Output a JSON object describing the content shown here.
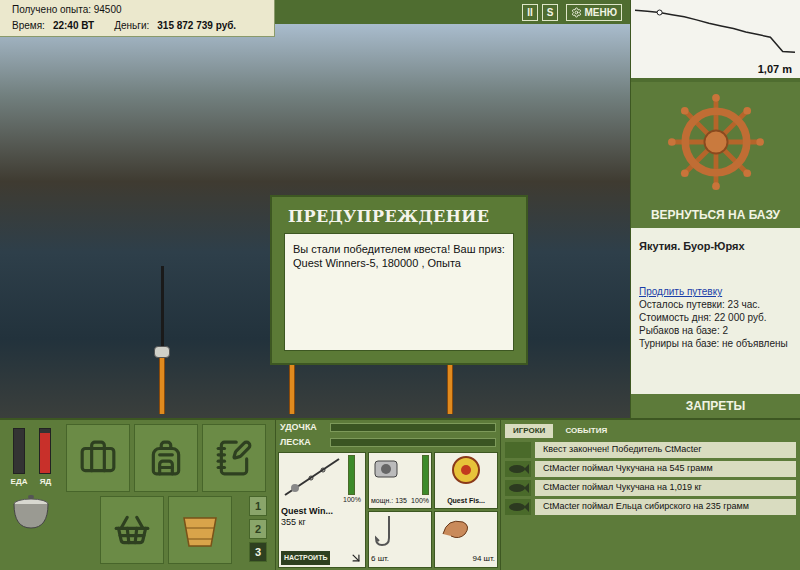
{
  "hud": {
    "experience": "Получено опыта: 94500",
    "time_label": "Время:",
    "time": "22:40 ВТ",
    "money_label": "Деньги:",
    "money": "315 872 739 руб."
  },
  "toolbar": {
    "buttons": [
      "II",
      "S",
      "МЕНЮ"
    ]
  },
  "depth_chart": {
    "reading": "1,07 m",
    "profile": [
      0.1,
      0.12,
      0.15,
      0.2,
      0.25,
      0.32,
      0.4,
      0.46,
      0.52,
      0.6,
      0.66,
      0.72,
      1.05,
      1.07
    ],
    "marker_index": 2
  },
  "dialog": {
    "title": "ПРЕДУПРЕЖДЕНИЕ",
    "message": "Вы стали победителем квеста! Ваш приз: Quest Winners-5, 180000 , Опыта"
  },
  "base": {
    "button": "ВЕРНУТЬСЯ НА БАЗУ",
    "location": "Якутия. Буор-Юрях",
    "extend_link": "Продлить путевку",
    "info": [
      "Осталось путевки: 23 час.",
      "Стоимость дня: 22 000 руб.",
      "Рыбаков на базе: 2",
      "Турниры на базе: не объявлены"
    ],
    "bans_button": "ЗАПРЕТЫ"
  },
  "needs": [
    {
      "label": "ЕДА",
      "level": 0.0,
      "color": "#2a2a2a"
    },
    {
      "label": "ЯД",
      "level": 0.9,
      "color": "#c8302a"
    }
  ],
  "sets": [
    {
      "label": "1",
      "selected": false
    },
    {
      "label": "2",
      "selected": false
    },
    {
      "label": "3",
      "selected": true
    }
  ],
  "tension": [
    {
      "label": "УДОЧКА",
      "level": 0
    },
    {
      "label": "ЛЕСКА",
      "level": 0
    }
  ],
  "tackle": {
    "rod": {
      "name": "Quest Win...",
      "load": "355 кг",
      "condition": "100%",
      "level": 1,
      "button": "НАСТРОИТЬ"
    },
    "reel": {
      "power": "мощн.: 135",
      "condition": "100%",
      "level": 1
    },
    "line": {
      "name": "Quest Fis..."
    },
    "hook": {
      "count": "6 шт."
    },
    "bait": {
      "count": "94 шт."
    }
  },
  "events": {
    "tabs": [
      {
        "label": "ИГРОКИ",
        "selected": true
      },
      {
        "label": "СОБЫТИЯ",
        "selected": false
      }
    ],
    "messages": [
      {
        "text": "Квест закончен! Победитель CtMacter",
        "fish": false
      },
      {
        "text": "CtMacter поймал Чукучана на 545 грамм",
        "fish": true
      },
      {
        "text": "CtMacter поймал Чукучана на 1,019 кг",
        "fish": true
      },
      {
        "text": "CtMacter поймал Ельца сибирского на 235 грамм",
        "fish": true
      }
    ]
  }
}
